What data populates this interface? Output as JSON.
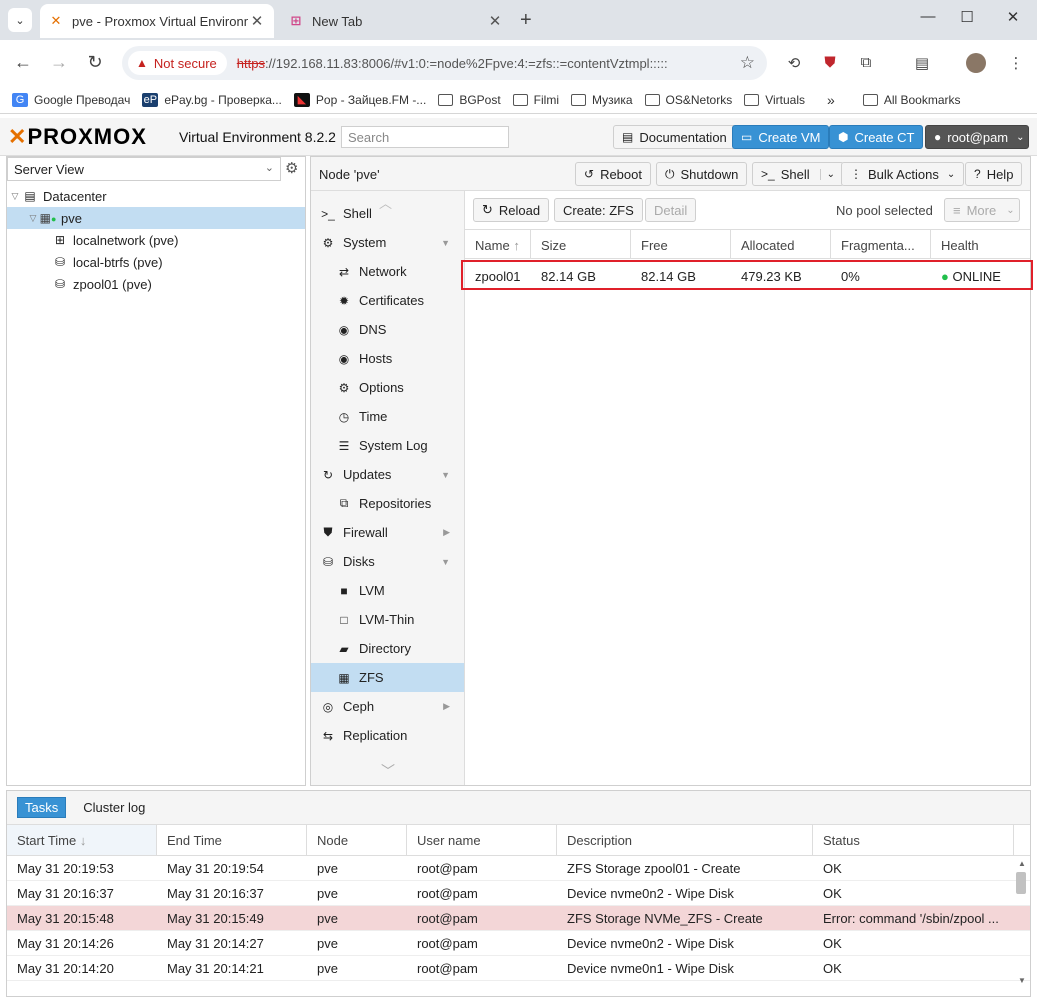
{
  "browser": {
    "tabs": [
      {
        "title": "pve - Proxmox Virtual Environm",
        "active": true
      },
      {
        "title": "New Tab",
        "active": false
      }
    ],
    "security_label": "Not secure",
    "url_scheme": "https",
    "url_rest": "://192.168.11.83:8006/#v1:0:=node%2Fpve:4:=zfs::=contentVztmpl:::::",
    "bookmarks": [
      {
        "label": "Google Преводач",
        "icon": "google-translate-icon"
      },
      {
        "label": "ePay.bg - Проверка...",
        "icon": "epay-icon"
      },
      {
        "label": "Pop - Зайцев.FM -...",
        "icon": "zaycev-icon"
      },
      {
        "label": "BGPost",
        "icon": "folder-icon"
      },
      {
        "label": "Filmi",
        "icon": "folder-icon"
      },
      {
        "label": "Музика",
        "icon": "folder-icon"
      },
      {
        "label": "OS&Netorks",
        "icon": "folder-icon"
      },
      {
        "label": "Virtuals",
        "icon": "folder-icon"
      }
    ],
    "all_bookmarks": "All Bookmarks"
  },
  "header": {
    "version": "Virtual Environment 8.2.2",
    "search_placeholder": "Search",
    "documentation": "Documentation",
    "create_vm": "Create VM",
    "create_ct": "Create CT",
    "user": "root@pam"
  },
  "left": {
    "view": "Server View",
    "tree": [
      {
        "label": "Datacenter",
        "level": 0
      },
      {
        "label": "pve",
        "level": 1,
        "selected": true
      },
      {
        "label": "localnetwork (pve)",
        "level": 2
      },
      {
        "label": "local-btrfs (pve)",
        "level": 2
      },
      {
        "label": "zpool01 (pve)",
        "level": 2
      }
    ]
  },
  "node": {
    "title": "Node 'pve'",
    "reboot": "Reboot",
    "shutdown": "Shutdown",
    "shell": "Shell",
    "bulk": "Bulk Actions",
    "help": "Help"
  },
  "nav": [
    {
      "label": "Shell",
      "sub": false
    },
    {
      "label": "System",
      "sub": false,
      "arrow": "down"
    },
    {
      "label": "Network",
      "sub": true
    },
    {
      "label": "Certificates",
      "sub": true
    },
    {
      "label": "DNS",
      "sub": true
    },
    {
      "label": "Hosts",
      "sub": true
    },
    {
      "label": "Options",
      "sub": true
    },
    {
      "label": "Time",
      "sub": true
    },
    {
      "label": "System Log",
      "sub": true
    },
    {
      "label": "Updates",
      "sub": false,
      "arrow": "down"
    },
    {
      "label": "Repositories",
      "sub": true
    },
    {
      "label": "Firewall",
      "sub": false,
      "arrow": "right"
    },
    {
      "label": "Disks",
      "sub": false,
      "arrow": "down"
    },
    {
      "label": "LVM",
      "sub": true
    },
    {
      "label": "LVM-Thin",
      "sub": true
    },
    {
      "label": "Directory",
      "sub": true
    },
    {
      "label": "ZFS",
      "sub": true,
      "selected": true
    },
    {
      "label": "Ceph",
      "sub": false,
      "arrow": "right"
    },
    {
      "label": "Replication",
      "sub": false
    }
  ],
  "zfs": {
    "reload": "Reload",
    "create": "Create: ZFS",
    "detail": "Detail",
    "pool_status": "No pool selected",
    "more": "More",
    "columns": [
      "Name",
      "Size",
      "Free",
      "Allocated",
      "Fragmenta...",
      "Health"
    ],
    "rows": [
      {
        "name": "zpool01",
        "size": "82.14 GB",
        "free": "82.14 GB",
        "allocated": "479.23 KB",
        "frag": "0%",
        "health": "ONLINE"
      }
    ]
  },
  "tasks": {
    "tab_tasks": "Tasks",
    "tab_cluster": "Cluster log",
    "columns": [
      "Start Time",
      "End Time",
      "Node",
      "User name",
      "Description",
      "Status"
    ],
    "rows": [
      {
        "start": "May 31 20:19:53",
        "end": "May 31 20:19:54",
        "node": "pve",
        "user": "root@pam",
        "desc": "ZFS Storage zpool01 - Create",
        "status": "OK",
        "error": false
      },
      {
        "start": "May 31 20:16:37",
        "end": "May 31 20:16:37",
        "node": "pve",
        "user": "root@pam",
        "desc": "Device nvme0n2 - Wipe Disk",
        "status": "OK",
        "error": false
      },
      {
        "start": "May 31 20:15:48",
        "end": "May 31 20:15:49",
        "node": "pve",
        "user": "root@pam",
        "desc": "ZFS Storage NVMe_ZFS - Create",
        "status": "Error: command '/sbin/zpool ...",
        "error": true
      },
      {
        "start": "May 31 20:14:26",
        "end": "May 31 20:14:27",
        "node": "pve",
        "user": "root@pam",
        "desc": "Device nvme0n2 - Wipe Disk",
        "status": "OK",
        "error": false
      },
      {
        "start": "May 31 20:14:20",
        "end": "May 31 20:14:21",
        "node": "pve",
        "user": "root@pam",
        "desc": "Device nvme0n1 - Wipe Disk",
        "status": "OK",
        "error": false
      }
    ]
  },
  "colors": {
    "accent": "#3892d4",
    "brand": "#e57000",
    "highlight": "#e0202a",
    "ok": "#21bf4b"
  }
}
